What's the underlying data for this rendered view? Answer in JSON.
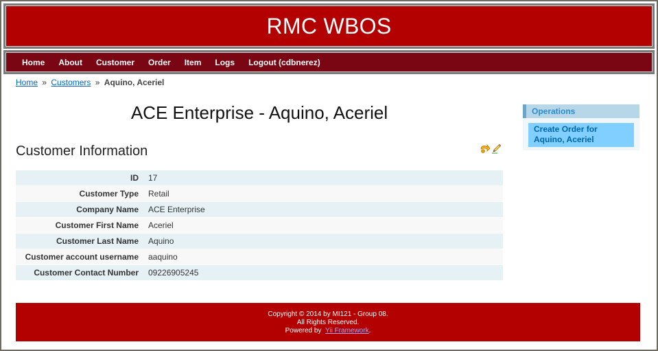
{
  "header": {
    "logo": "RMC WBOS"
  },
  "menu": {
    "items": [
      {
        "label": "Home"
      },
      {
        "label": "About"
      },
      {
        "label": "Customer"
      },
      {
        "label": "Order"
      },
      {
        "label": "Item"
      },
      {
        "label": "Logs"
      },
      {
        "label": "Logout (cdbnerez)"
      }
    ]
  },
  "breadcrumb": {
    "home": "Home",
    "sep": "»",
    "customers": "Customers",
    "current": "Aquino, Aceriel"
  },
  "main": {
    "title": "ACE Enterprise - Aquino, Aceriel",
    "section_title": "Customer Information",
    "rows": [
      {
        "label": "ID",
        "value": "17"
      },
      {
        "label": "Customer Type",
        "value": "Retail"
      },
      {
        "label": "Company Name",
        "value": "ACE Enterprise"
      },
      {
        "label": "Customer First Name",
        "value": "Aceriel"
      },
      {
        "label": "Customer Last Name",
        "value": "Aquino"
      },
      {
        "label": "Customer account username",
        "value": "aaquino"
      },
      {
        "label": "Customer Contact Number",
        "value": "09226905245"
      }
    ],
    "action_icons": [
      "back-arrow-icon",
      "pencil-edit-icon"
    ]
  },
  "sidebar": {
    "title": "Operations",
    "operations": [
      {
        "label": "Create Order for Aquino, Aceriel"
      }
    ]
  },
  "footer": {
    "line1": "Copyright © 2014 by MI121 - Group 08.",
    "line2": "All Rights Reserved.",
    "powered_prefix": "Powered by",
    "framework_link": "Yii Framework",
    "powered_suffix": "."
  },
  "colors": {
    "header_red": "#b30000",
    "menu_maroon": "#7a0613",
    "row_odd": "#e5f1f4",
    "row_even": "#f8f8f8",
    "sidebar_title_bg": "#b7d6e7",
    "operation_bg": "#80cfff"
  }
}
